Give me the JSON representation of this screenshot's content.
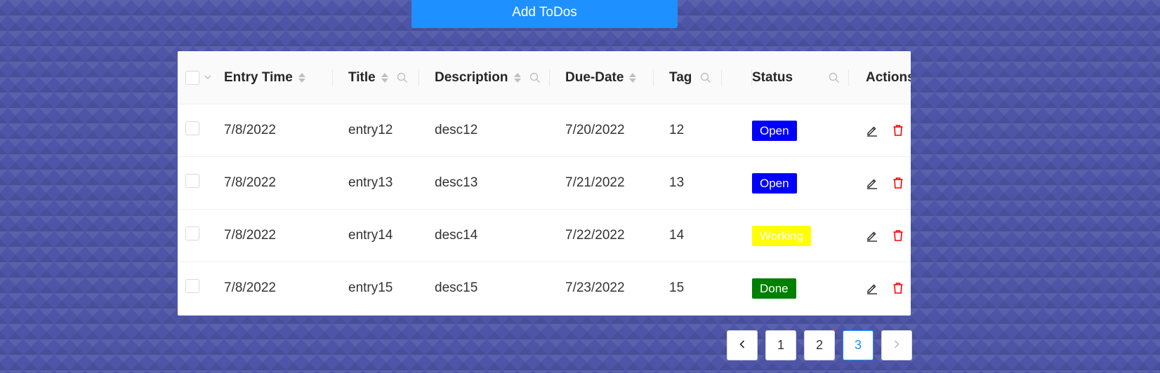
{
  "add_button": {
    "label": "Add ToDos"
  },
  "table": {
    "columns": [
      {
        "key": "entry_time",
        "label": "Entry Time"
      },
      {
        "key": "title",
        "label": "Title"
      },
      {
        "key": "description",
        "label": "Description"
      },
      {
        "key": "due_date",
        "label": "Due-Date"
      },
      {
        "key": "tag",
        "label": "Tag"
      },
      {
        "key": "status",
        "label": "Status"
      },
      {
        "key": "actions",
        "label": "Actions"
      }
    ],
    "rows": [
      {
        "entry_time": "7/8/2022",
        "title": "entry12",
        "description": "desc12",
        "due_date": "7/20/2022",
        "tag": "12",
        "status": "Open",
        "status_color": "#0000ff"
      },
      {
        "entry_time": "7/8/2022",
        "title": "entry13",
        "description": "desc13",
        "due_date": "7/21/2022",
        "tag": "13",
        "status": "Open",
        "status_color": "#0000ff"
      },
      {
        "entry_time": "7/8/2022",
        "title": "entry14",
        "description": "desc14",
        "due_date": "7/22/2022",
        "tag": "14",
        "status": "Working",
        "status_color": "#ffff00"
      },
      {
        "entry_time": "7/8/2022",
        "title": "entry15",
        "description": "desc15",
        "due_date": "7/23/2022",
        "tag": "15",
        "status": "Done",
        "status_color": "#008000"
      }
    ]
  },
  "pagination": {
    "pages": [
      "1",
      "2",
      "3"
    ],
    "current": "3",
    "prev_icon": "chevron-left-icon",
    "next_icon": "chevron-right-icon"
  },
  "icons": {
    "edit": "edit-icon",
    "delete": "trash-icon",
    "search": "search-icon",
    "select_dropdown": "chevron-down-icon"
  },
  "colors": {
    "primary": "#1e90ff",
    "background": "#4e55a6",
    "delete_icon": "#ff0000",
    "active_page": "#1890ff"
  }
}
